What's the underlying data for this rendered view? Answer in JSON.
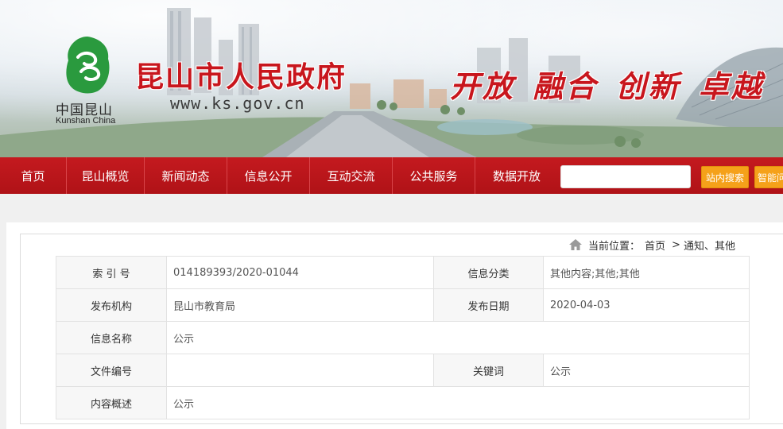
{
  "header": {
    "logo_cn": "中国昆山",
    "logo_en": "Kunshan China",
    "title": "昆山市人民政府",
    "url": "www.ks.gov.cn",
    "slogan": "开放 融合 创新 卓越"
  },
  "nav": {
    "items": [
      {
        "label": "首页"
      },
      {
        "label": "昆山概览"
      },
      {
        "label": "新闻动态"
      },
      {
        "label": "信息公开"
      },
      {
        "label": "互动交流"
      },
      {
        "label": "公共服务"
      },
      {
        "label": "数据开放"
      }
    ],
    "search": {
      "placeholder": "",
      "value": ""
    },
    "site_search_label": "站内搜索",
    "smart_qa_label": "智能问答"
  },
  "breadcrumb": {
    "prefix": "当前位置：",
    "items": [
      "首页",
      "通知、其他"
    ],
    "separator": ">"
  },
  "meta_table": {
    "index_no_label": "索 引 号",
    "index_no": "014189393/2020-01044",
    "category_label": "信息分类",
    "category": "其他内容;其他;其他",
    "publisher_label": "发布机构",
    "publisher": "昆山市教育局",
    "date_label": "发布日期",
    "date": "2020-04-03",
    "name_label": "信息名称",
    "name": "公示",
    "doc_no_label": "文件编号",
    "doc_no": "",
    "keywords_label": "关键词",
    "keywords": "公示",
    "summary_label": "内容概述",
    "summary": "公示"
  },
  "colors": {
    "brand_red": "#c41a1f",
    "accent_orange": "#f5a11a"
  }
}
